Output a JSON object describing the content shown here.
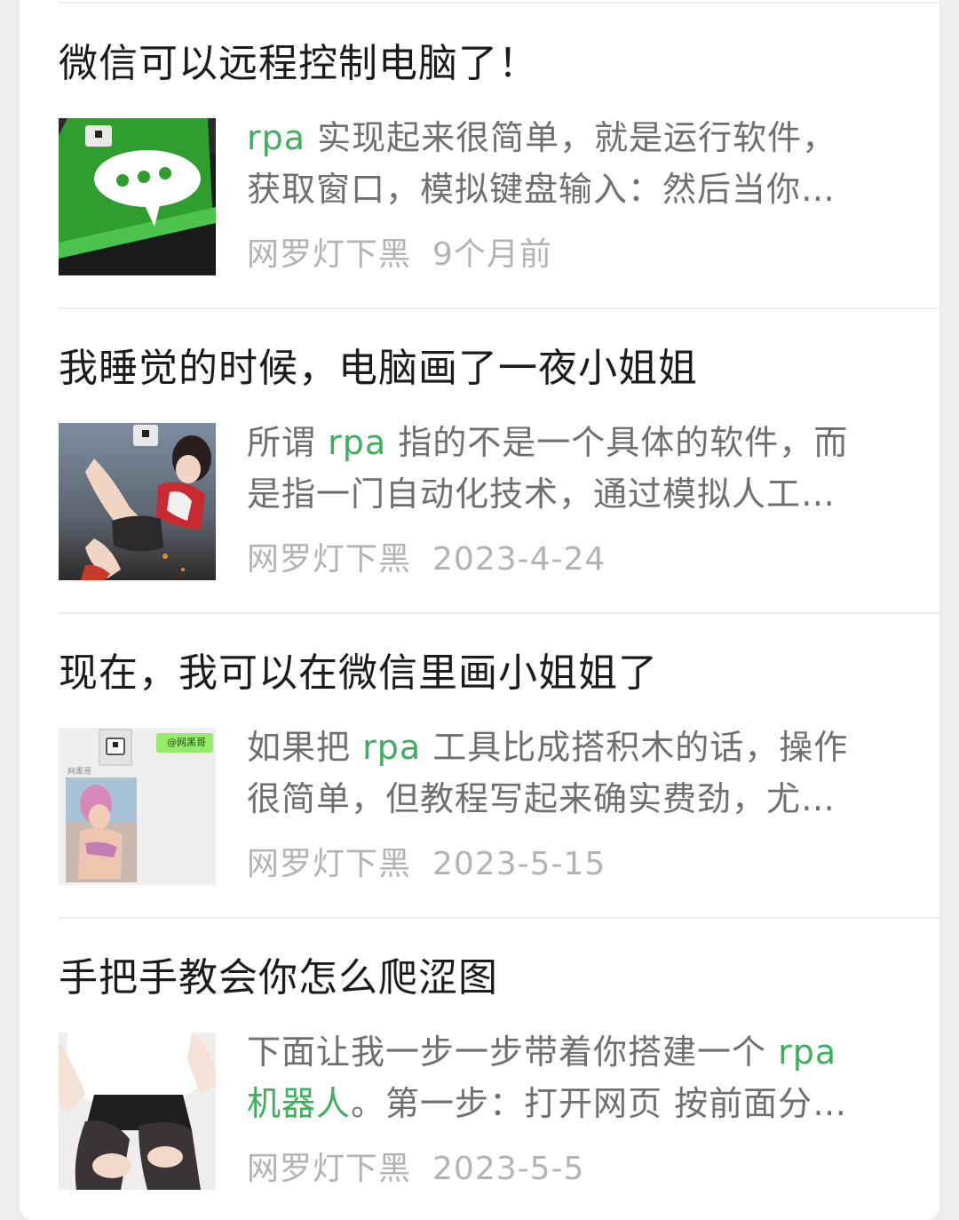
{
  "articles": [
    {
      "title": "微信可以远程控制电脑了！",
      "snippet_line1": {
        "keyword": "rpa",
        "before": "",
        "after": " 实现起来很简单，就是运行软件，"
      },
      "snippet_line2": "获取窗口，模拟键盘输入：然后当你…",
      "author": "网罗灯下黑",
      "date": "9个月前",
      "thumbnail": "wechat-bubble-thumbnail"
    },
    {
      "title": "我睡觉的时候，电脑画了一夜小姐姐",
      "snippet_line1": {
        "keyword": "rpa",
        "before": "所谓 ",
        "after": " 指的不是一个具体的软件，而"
      },
      "snippet_line2": "是指一门自动化技术，通过模拟人工…",
      "author": "网罗灯下黑",
      "date": "2023-4-24",
      "thumbnail": "game-character-thumbnail"
    },
    {
      "title": "现在，我可以在微信里画小姐姐了",
      "snippet_line1": {
        "keyword": "rpa",
        "before": "如果把 ",
        "after": " 工具比成搭积木的话，操作"
      },
      "snippet_line2": "很简单，但教程写起来确实费劲，尤…",
      "author": "网罗灯下黑",
      "date": "2023-5-15",
      "thumbnail": "wechat-chat-thumbnail",
      "thumbnail_tag": "@网黑哥",
      "thumbnail_caption": "网黑哥"
    },
    {
      "title": "手把手教会你怎么爬涩图",
      "snippet_line1": {
        "keyword": "rpa",
        "before": "下面让我一步一步带着你搭建一个 ",
        "after": ""
      },
      "snippet_line2_keyword": "机器人",
      "snippet_line2": "。第一步：打开网页 按前面分…",
      "author": "网罗灯下黑",
      "date": "2023-5-5",
      "thumbnail": "photo-thumbnail"
    }
  ],
  "colors": {
    "keyword": "#3fae5f",
    "title": "#1b1b1b",
    "snippet": "#6f6f6f",
    "meta": "#b3b3b3",
    "page_bg": "#ededed",
    "card_bg": "#ffffff"
  }
}
